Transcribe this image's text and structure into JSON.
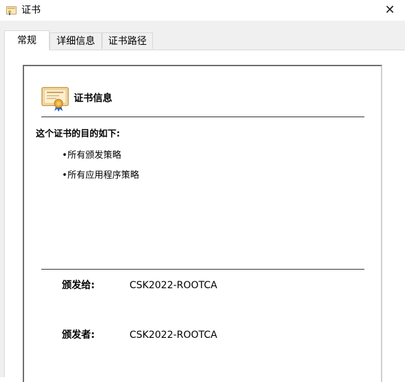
{
  "window": {
    "title": "证书",
    "icon": "certificate-icon",
    "close_symbol": "✕"
  },
  "tabs": [
    {
      "label": "常规",
      "active": true
    },
    {
      "label": "详细信息",
      "active": false
    },
    {
      "label": "证书路径",
      "active": false
    }
  ],
  "certificate": {
    "heading": "证书信息",
    "purpose_heading": "这个证书的目的如下:",
    "purposes": [
      "所有颁发策略",
      "所有应用程序策略"
    ],
    "bullet": "•",
    "issued_to_label": "颁发给:",
    "issued_to_value": "CSK2022-ROOTCA",
    "issued_by_label": "颁发者:",
    "issued_by_value": "CSK2022-ROOTCA"
  },
  "colors": {
    "dialog_bg": "#f0f0f0",
    "panel_bg": "#ffffff",
    "cert_icon_gold": "#e8a93a",
    "ribbon_blue": "#3a74c9"
  }
}
